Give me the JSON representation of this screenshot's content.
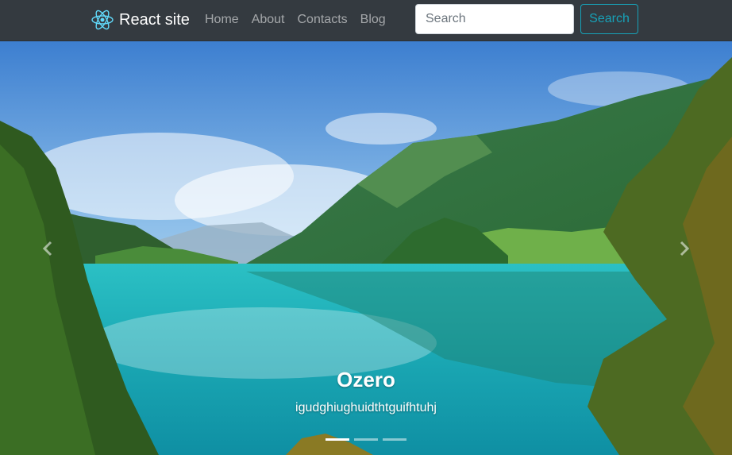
{
  "navbar": {
    "brand": "React site",
    "links": [
      "Home",
      "About",
      "Contacts",
      "Blog"
    ],
    "search_placeholder": "Search",
    "search_button": "Search"
  },
  "carousel": {
    "caption_title": "Ozero",
    "caption_text": "igudghiughuidthtguifhtuhj",
    "active_slide": 1,
    "slide_count": 3
  },
  "colors": {
    "navbar_bg": "#343a40",
    "search_accent": "#17a2b8",
    "logo": "#61dafb"
  }
}
